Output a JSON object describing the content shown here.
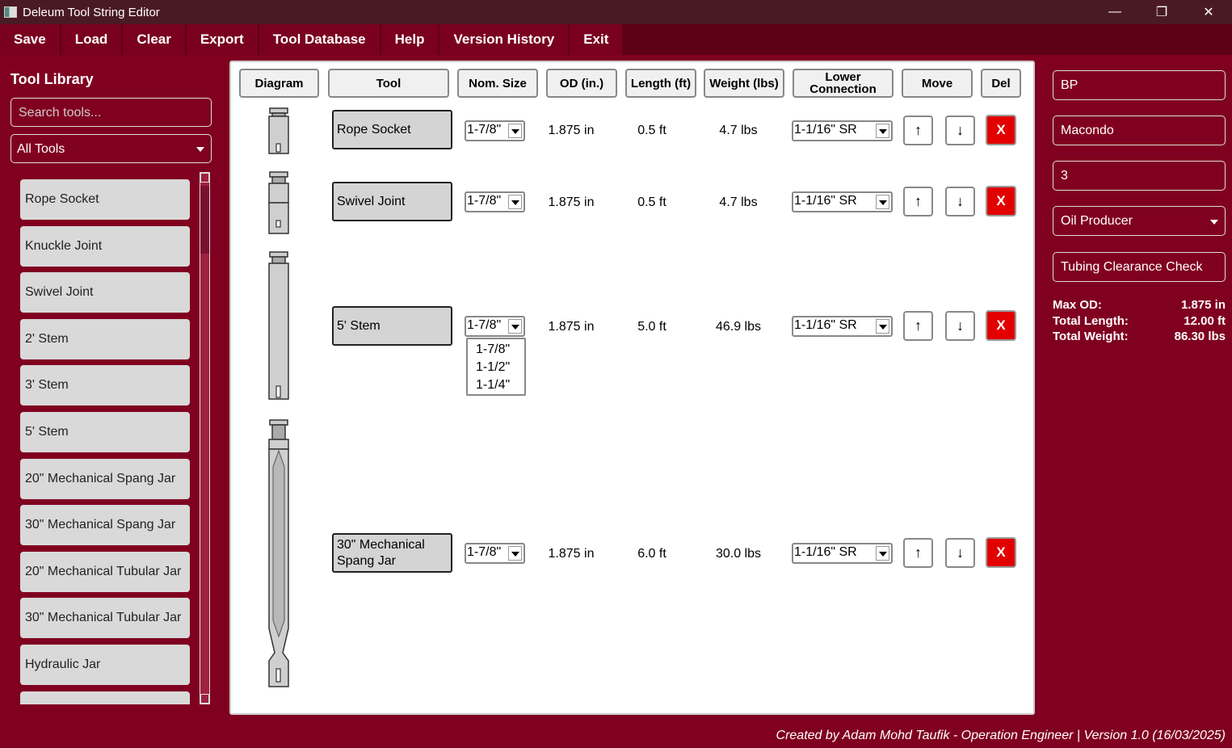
{
  "window": {
    "title": "Deleum Tool String Editor"
  },
  "menu": [
    "Save",
    "Load",
    "Clear",
    "Export",
    "Tool Database",
    "Help",
    "Version History",
    "Exit"
  ],
  "library": {
    "title": "Tool Library",
    "search_placeholder": "Search tools...",
    "filter_selected": "All Tools",
    "items": [
      "Rope Socket",
      "Knuckle Joint",
      "Swivel Joint",
      "2' Stem",
      "3' Stem",
      "5' Stem",
      "20\" Mechanical Spang Jar",
      "30\" Mechanical Spang Jar",
      "20\" Mechanical Tubular Jar",
      "30\" Mechanical Tubular Jar",
      "Hydraulic Jar",
      ""
    ]
  },
  "table": {
    "headers": {
      "diagram": "Diagram",
      "tool": "Tool",
      "nom": "Nom. Size",
      "od": "OD (in.)",
      "length": "Length (ft)",
      "weight": "Weight (lbs)",
      "lower1": "Lower",
      "lower2": "Connection",
      "move": "Move",
      "del": "Del"
    },
    "rows": [
      {
        "tool": "Rope Socket",
        "nom": "1-7/8\"",
        "od": "1.875 in",
        "length": "0.5 ft",
        "weight": "4.7 lbs",
        "conn": "1-1/16\" SR",
        "up": "↑",
        "down": "↓",
        "del": "X"
      },
      {
        "tool": "Swivel Joint",
        "nom": "1-7/8\"",
        "od": "1.875 in",
        "length": "0.5 ft",
        "weight": "4.7 lbs",
        "conn": "1-1/16\" SR",
        "up": "↑",
        "down": "↓",
        "del": "X"
      },
      {
        "tool": "5' Stem",
        "nom": "1-7/8\"",
        "od": "1.875 in",
        "length": "5.0 ft",
        "weight": "46.9 lbs",
        "conn": "1-1/16\" SR",
        "up": "↑",
        "down": "↓",
        "del": "X"
      },
      {
        "tool": "30\" Mechanical Spang Jar",
        "nom": "1-7/8\"",
        "od": "1.875 in",
        "length": "6.0 ft",
        "weight": "30.0 lbs",
        "conn": "1-1/16\" SR",
        "up": "↑",
        "down": "↓",
        "del": "X"
      }
    ],
    "open_dropdown_options": [
      "1-7/8\"",
      "1-1/2\"",
      "1-1/4\""
    ]
  },
  "right": {
    "company": "BP",
    "well": "Macondo",
    "run": "3",
    "well_type": "Oil Producer",
    "check_button": "Tubing Clearance Check",
    "stats": [
      {
        "label": "Max OD:",
        "value": "1.875 in"
      },
      {
        "label": "Total Length:",
        "value": "12.00 ft"
      },
      {
        "label": "Total Weight:",
        "value": "86.30 lbs"
      }
    ]
  },
  "footer": "Created by Adam Mohd Taufik - Operation Engineer  |  Version 1.0 (16/03/2025)"
}
